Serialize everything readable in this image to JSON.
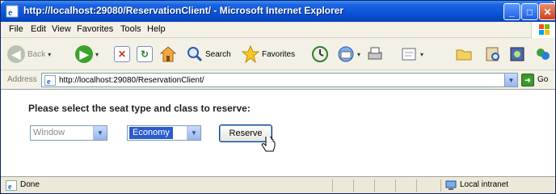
{
  "window": {
    "title": "http://localhost:29080/ReservationClient/ - Microsoft Internet Explorer"
  },
  "menu": [
    "File",
    "Edit",
    "View",
    "Favorites",
    "Tools",
    "Help"
  ],
  "toolbar": {
    "back_label": "Back",
    "search_label": "Search",
    "favorites_label": "Favorites"
  },
  "address": {
    "label": "Address",
    "url": "http://localhost:29080/ReservationClient/",
    "go_label": "Go"
  },
  "form": {
    "prompt": "Please select the seat type and class to reserve:",
    "seat_type": "Window",
    "seat_class": "Economy",
    "reserve_label": "Reserve"
  },
  "status": {
    "text": "Done",
    "zone": "Local intranet"
  },
  "icons": {
    "ie": "ie-page-icon",
    "back": "back-arrow-icon",
    "forward": "forward-arrow-icon",
    "stop": "stop-icon",
    "refresh": "refresh-icon",
    "home": "home-icon",
    "search": "search-icon",
    "favorites": "favorites-star-icon",
    "history": "history-icon",
    "mail": "mail-icon",
    "print": "print-icon",
    "edit": "edit-icon",
    "folder": "folder-icon",
    "messenger": "messenger-icon",
    "cursor": "hand-cursor-icon"
  },
  "colors": {
    "titlebar": "#0a52d9",
    "chrome": "#ece9d8",
    "selection": "#2b5bd0"
  }
}
